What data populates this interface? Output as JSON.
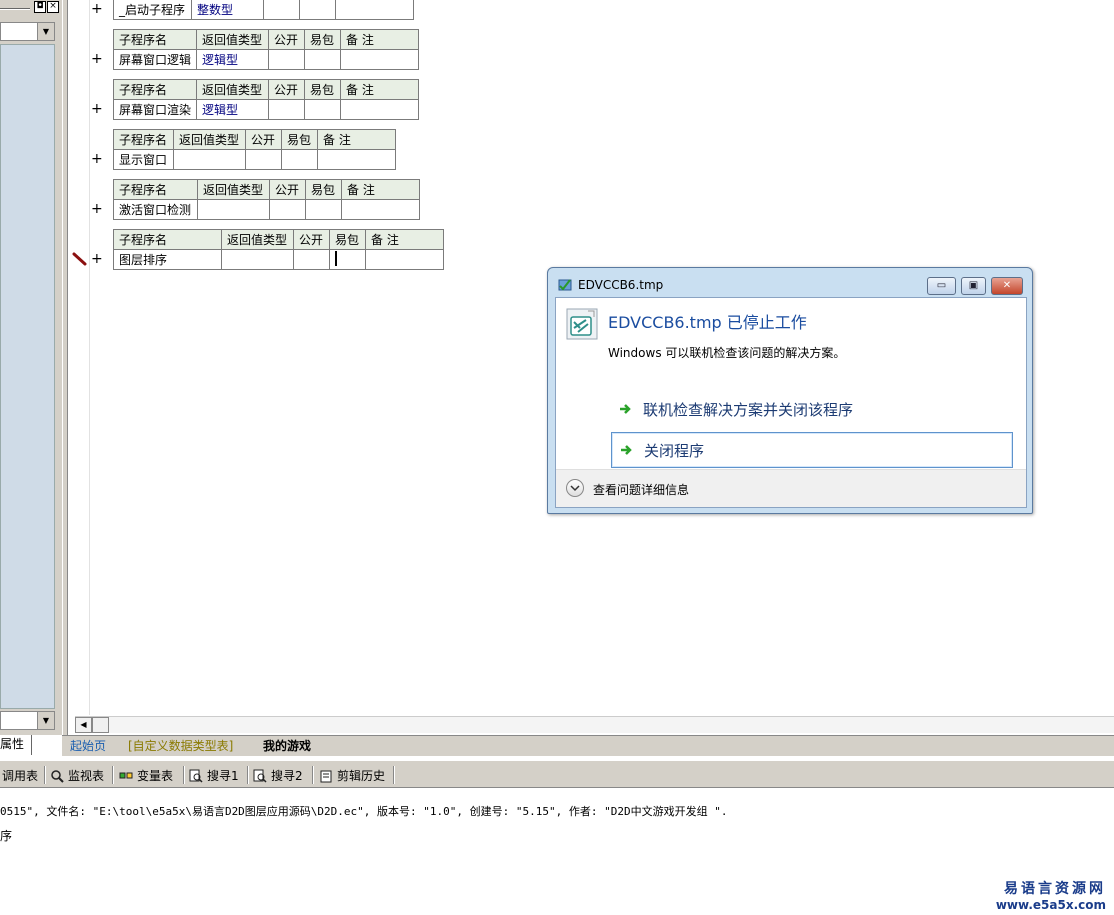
{
  "left_panel": {
    "tab_label": "属性",
    "pin_glyph": "◘",
    "close_glyph": "×",
    "dropdown_glyph": "▼"
  },
  "subroutine_tables": [
    {
      "header": [
        "子程序名",
        "返回值类型",
        "公开",
        "易包",
        "备 注"
      ],
      "name": "_启动子程序",
      "return_type": "整数型",
      "show_header": false
    },
    {
      "header": [
        "子程序名",
        "返回值类型",
        "公开",
        "易包",
        "备 注"
      ],
      "name": "屏幕窗口逻辑",
      "return_type": "逻辑型",
      "show_header": true
    },
    {
      "header": [
        "子程序名",
        "返回值类型",
        "公开",
        "易包",
        "备 注"
      ],
      "name": "屏幕窗口渲染",
      "return_type": "逻辑型",
      "show_header": true
    },
    {
      "header": [
        "子程序名",
        "返回值类型",
        "公开",
        "易包",
        "备 注"
      ],
      "name": "显示窗口",
      "return_type": "",
      "show_header": true
    },
    {
      "header": [
        "子程序名",
        "返回值类型",
        "公开",
        "易包",
        "备 注"
      ],
      "name": "激活窗口检测",
      "return_type": "",
      "show_header": true
    },
    {
      "header": [
        "子程序名",
        "返回值类型",
        "公开",
        "易包",
        "备 注"
      ],
      "name": "图层排序",
      "return_type": "",
      "show_header": true
    }
  ],
  "expand_glyph": "+",
  "doc_tabs": [
    {
      "label": "起始页",
      "color": "#1b5fb0"
    },
    {
      "label": "[自定义数据类型表]",
      "color": "#8a7a00"
    },
    {
      "label": "我的游戏",
      "color": "#000000"
    }
  ],
  "toolbar": {
    "items": [
      "调用表",
      "监视表",
      "变量表",
      "搜寻1",
      "搜寻2",
      "剪辑历史"
    ]
  },
  "output": {
    "line1": "0515\", 文件名: \"E:\\tool\\e5a5x\\易语言D2D图层应用源码\\D2D.ec\", 版本号: \"1.0\", 创建号: \"5.15\", 作者: \"D2D中文游戏开发组  \".",
    "line2": "序"
  },
  "watermark": {
    "title": "易语言资源网",
    "url": "www.e5a5x.com"
  },
  "dialog": {
    "window_title": "EDVCCB6.tmp",
    "heading": "EDVCCB6.tmp 已停止工作",
    "description": "Windows 可以联机检查该问题的解决方案。",
    "option_check_online": "联机检查解决方案并关闭该程序",
    "option_close": "关闭程序",
    "details_label": "查看问题详细信息",
    "minimize_glyph": "▭",
    "maximize_glyph": "▣",
    "close_glyph": "✕"
  }
}
